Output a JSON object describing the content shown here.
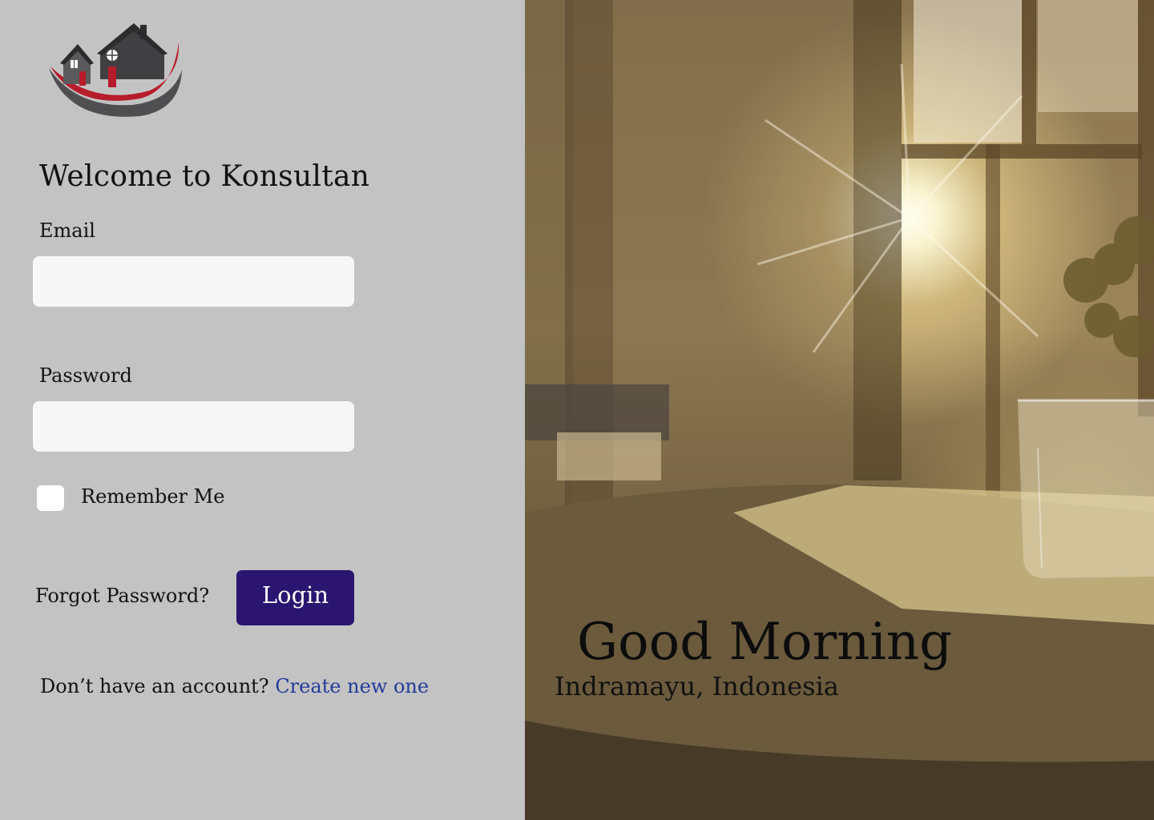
{
  "login": {
    "welcome_title": "Welcome to Konsultan",
    "email_label": "Email",
    "email_value": "",
    "password_label": "Password",
    "password_value": "",
    "remember_label": "Remember Me",
    "remember_checked": false,
    "forgot_label": "Forgot Password?",
    "login_label": "Login",
    "signup_prompt": "Don’t have an account?",
    "signup_link": "Create new one"
  },
  "hero": {
    "greeting": "Good Morning",
    "location": "Indramayu, Indonesia"
  },
  "icons": {
    "logo": "house-logo-icon",
    "checkbox": "checkbox-icon"
  },
  "colors": {
    "panel_bg": "#c3c3c3",
    "input_bg": "#f8f7f8",
    "login_button": "#2a1570",
    "link": "#233a9a",
    "logo_red": "#b71c2b",
    "logo_gray": "#4a4a4c"
  }
}
